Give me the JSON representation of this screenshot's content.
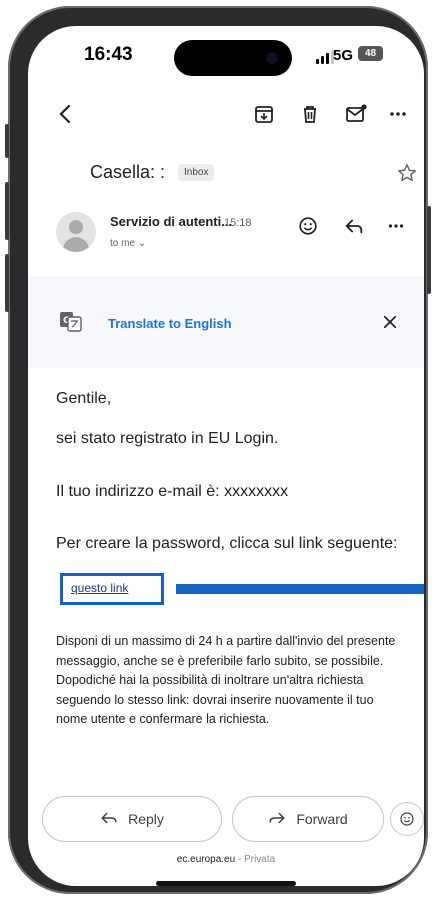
{
  "status_bar": {
    "time": "16:43",
    "network": "5G",
    "battery": "48"
  },
  "email": {
    "subject": "Casella: :",
    "label": "Inbox",
    "sender": "Servizio di autenti...",
    "time": "15:18",
    "recipient": "to me",
    "translate_label": "Translate to English",
    "body": {
      "greeting": "Gentile,",
      "line1": "sei stato registrato in EU Login.",
      "line2": "Il tuo indirizzo e-mail è: xxxxxxxx",
      "line3": "Per creare la password, clicca sul link seguente:",
      "link_text": "questo link",
      "paragraph": "Disponi di un massimo di 24 h a partire dall'invio del presente messaggio, anche se è preferibile farlo subito, se possibile. Dopodiché hai la possibilità di inoltrare un'altra richiesta seguendo lo stesso link: dovrai inserire nuovamente il tuo nome utente e confermare la richiesta."
    }
  },
  "actions": {
    "reply": "Reply",
    "forward": "Forward"
  },
  "browser": {
    "url": "ec.europa.eu",
    "separator": " - ",
    "mode": "Privata"
  },
  "colors": {
    "accent": "#1565c0",
    "link": "#1a73e8",
    "translate_bg": "#f6f8fc"
  },
  "icons": [
    "back-arrow-icon",
    "archive-icon",
    "trash-icon",
    "mark-unread-icon",
    "more-vert-icon",
    "star-icon",
    "smiley-icon",
    "reply-icon",
    "translate-icon",
    "close-icon",
    "forward-icon"
  ]
}
